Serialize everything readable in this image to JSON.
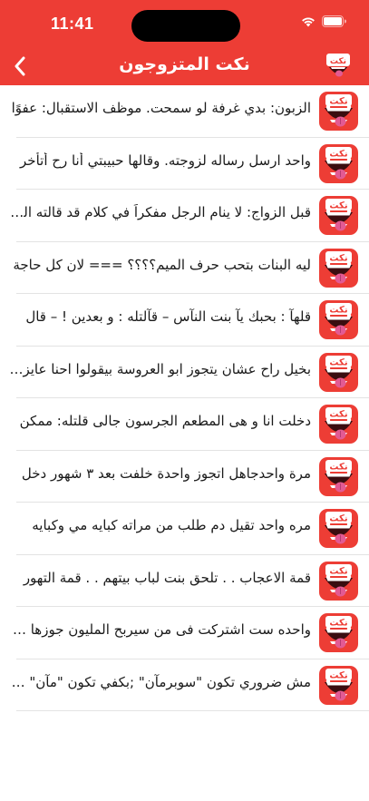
{
  "status": {
    "time": "11:41"
  },
  "nav": {
    "title": "نكت المتزوجون",
    "logo_text": "نكت"
  },
  "items": [
    {
      "text": "الزبون: بدي غرفة لو سمحت. موظف الاستقبال: عفوًا"
    },
    {
      "text": "واحد ارسل رساله لزوجته. وقالها حبيبتي أنا رح أتأخر"
    },
    {
      "text": "قبل الزواج: لا ينام الرجل مفكراً في كلام قد قالته الزوجة"
    },
    {
      "text": "ليه البنات بتحب حرف الميم؟؟؟؟ === لان كل حاجة"
    },
    {
      "text": "قلهآ : بحبك يآ بنت النآس – قآلتله : و بعدين ! – قال"
    },
    {
      "text": "بخيل راح عشان يتجوز ابو العروسة بيقولوا احنا عايزين"
    },
    {
      "text": "دخلت انا و هى المطعم الجرسون جالى قلتله: ممكن"
    },
    {
      "text": "مرة واحدجاهل اتجوز واحدة خلفت بعد ٣ شهور دخل"
    },
    {
      "text": "مره واحد تقيل دم طلب من مراته كبايه مي وكبايه"
    },
    {
      "text": "قمة الاعجاب . . تلحق بنت لباب بيتهم . . قمة التهور"
    },
    {
      "text": "واحده ست اشتركت فى من سيربح المليون جوزها قالها"
    },
    {
      "text": "مش ضروري تكون \"سوبرمآن\" ;بكفي تكون \"مآن\" و بس"
    }
  ],
  "colors": {
    "header": "#ed3d35",
    "icon_bg": "#ed3d35",
    "divider": "#e3e3e3"
  },
  "icons": {
    "back": "chevron-left-icon",
    "app": "laughing-face-icon"
  }
}
